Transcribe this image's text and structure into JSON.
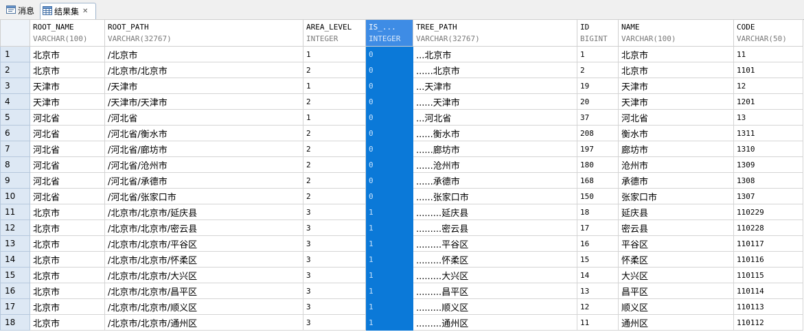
{
  "tabs": [
    {
      "label": "消息",
      "icon": "message-icon",
      "active": false
    },
    {
      "label": "结果集",
      "icon": "grid-table-icon",
      "active": true,
      "closable": true
    }
  ],
  "grid": {
    "columns": [
      {
        "name": "ROOT_NAME",
        "type": "VARCHAR(100)"
      },
      {
        "name": "ROOT_PATH",
        "type": "VARCHAR(32767)"
      },
      {
        "name": "AREA_LEVEL",
        "type": "INTEGER"
      },
      {
        "name": "IS_...",
        "type": "INTEGER"
      },
      {
        "name": "TREE_PATH",
        "type": "VARCHAR(32767)"
      },
      {
        "name": "ID",
        "type": "BIGINT"
      },
      {
        "name": "NAME",
        "type": "VARCHAR(100)"
      },
      {
        "name": "CODE",
        "type": "VARCHAR(50)"
      }
    ],
    "rows": [
      [
        "1",
        "北京市",
        "/北京市",
        "1",
        "0",
        "...北京市",
        "1",
        "北京市",
        "11"
      ],
      [
        "2",
        "北京市",
        "/北京市/北京市",
        "2",
        "0",
        "......北京市",
        "2",
        "北京市",
        "1101"
      ],
      [
        "3",
        "天津市",
        "/天津市",
        "1",
        "0",
        "...天津市",
        "19",
        "天津市",
        "12"
      ],
      [
        "4",
        "天津市",
        "/天津市/天津市",
        "2",
        "0",
        "......天津市",
        "20",
        "天津市",
        "1201"
      ],
      [
        "5",
        "河北省",
        "/河北省",
        "1",
        "0",
        "...河北省",
        "37",
        "河北省",
        "13"
      ],
      [
        "6",
        "河北省",
        "/河北省/衡水市",
        "2",
        "0",
        "......衡水市",
        "208",
        "衡水市",
        "1311"
      ],
      [
        "7",
        "河北省",
        "/河北省/廊坊市",
        "2",
        "0",
        "......廊坊市",
        "197",
        "廊坊市",
        "1310"
      ],
      [
        "8",
        "河北省",
        "/河北省/沧州市",
        "2",
        "0",
        "......沧州市",
        "180",
        "沧州市",
        "1309"
      ],
      [
        "9",
        "河北省",
        "/河北省/承德市",
        "2",
        "0",
        "......承德市",
        "168",
        "承德市",
        "1308"
      ],
      [
        "10",
        "河北省",
        "/河北省/张家口市",
        "2",
        "0",
        "......张家口市",
        "150",
        "张家口市",
        "1307"
      ],
      [
        "11",
        "北京市",
        "/北京市/北京市/延庆县",
        "3",
        "1",
        ".........延庆县",
        "18",
        "延庆县",
        "110229"
      ],
      [
        "12",
        "北京市",
        "/北京市/北京市/密云县",
        "3",
        "1",
        ".........密云县",
        "17",
        "密云县",
        "110228"
      ],
      [
        "13",
        "北京市",
        "/北京市/北京市/平谷区",
        "3",
        "1",
        ".........平谷区",
        "16",
        "平谷区",
        "110117"
      ],
      [
        "14",
        "北京市",
        "/北京市/北京市/怀柔区",
        "3",
        "1",
        ".........怀柔区",
        "15",
        "怀柔区",
        "110116"
      ],
      [
        "15",
        "北京市",
        "/北京市/北京市/大兴区",
        "3",
        "1",
        ".........大兴区",
        "14",
        "大兴区",
        "110115"
      ],
      [
        "16",
        "北京市",
        "/北京市/北京市/昌平区",
        "3",
        "1",
        ".........昌平区",
        "13",
        "昌平区",
        "110114"
      ],
      [
        "17",
        "北京市",
        "/北京市/北京市/顺义区",
        "3",
        "1",
        ".........顺义区",
        "12",
        "顺义区",
        "110113"
      ],
      [
        "18",
        "北京市",
        "/北京市/北京市/通州区",
        "3",
        "1",
        ".........通州区",
        "11",
        "通州区",
        "110112"
      ]
    ],
    "selected_column": "IS_...",
    "colors": {
      "selected_header": "#3e8ce5",
      "selected_cell": "#0b79d8",
      "row_header": "#dde8f4"
    }
  }
}
